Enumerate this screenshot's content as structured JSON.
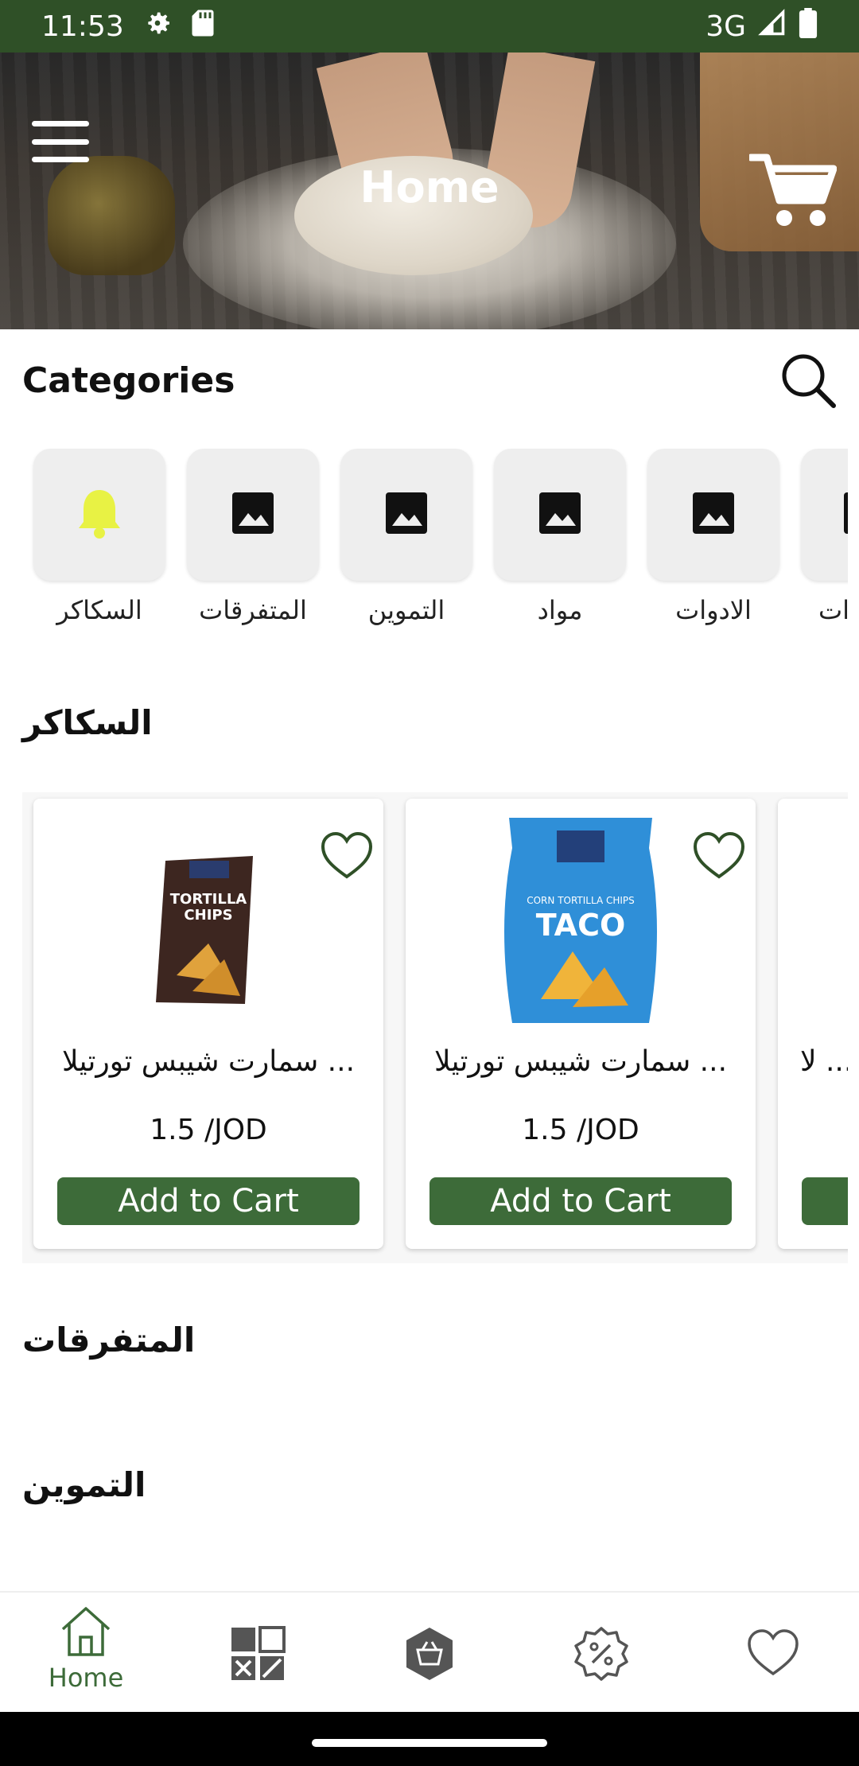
{
  "status_bar": {
    "time": "11:53",
    "network": "3G",
    "icons": [
      "settings-icon",
      "sd-card-icon",
      "signal-icon",
      "battery-icon"
    ]
  },
  "header": {
    "title": "Home",
    "menu_icon": "menu-icon",
    "cart_icon": "cart-icon"
  },
  "categories": {
    "title": "Categories",
    "search_icon": "search-icon",
    "items": [
      {
        "label": "السكاكر",
        "icon": "bell-icon"
      },
      {
        "label": "المتفرقات",
        "icon": "image-icon"
      },
      {
        "label": "التموين",
        "icon": "image-icon"
      },
      {
        "label": "مواد",
        "icon": "image-icon"
      },
      {
        "label": "الادوات",
        "icon": "image-icon"
      },
      {
        "label": "ات",
        "icon": "image-icon"
      }
    ]
  },
  "sections": [
    {
      "title": "السكاكر",
      "products": [
        {
          "name": "سمارت شيبس تورتيلا ...",
          "price": "1.5 /JOD",
          "button": "Add to Cart",
          "image": "tortilla-chips-barbecue"
        },
        {
          "name": "سمارت شيبس تورتيلا ...",
          "price": "1.5 /JOD",
          "button": "Add to Cart",
          "image": "corn-tortilla-chips-taco"
        },
        {
          "name": "لا ...",
          "price": "",
          "button": "",
          "image": "partial"
        }
      ]
    },
    {
      "title": "المتفرقات"
    },
    {
      "title": "التموين"
    }
  ],
  "bottom_nav": {
    "items": [
      {
        "label": "Home",
        "icon": "home-icon",
        "active": true
      },
      {
        "label": "",
        "icon": "grid-icon"
      },
      {
        "label": "",
        "icon": "basket-icon"
      },
      {
        "label": "",
        "icon": "discount-icon"
      },
      {
        "label": "",
        "icon": "heart-icon"
      }
    ]
  },
  "colors": {
    "primary": "#3d6b39",
    "status_bar": "#2f5027",
    "tile_bg": "#eeeeee",
    "bell": "#e8f244"
  }
}
